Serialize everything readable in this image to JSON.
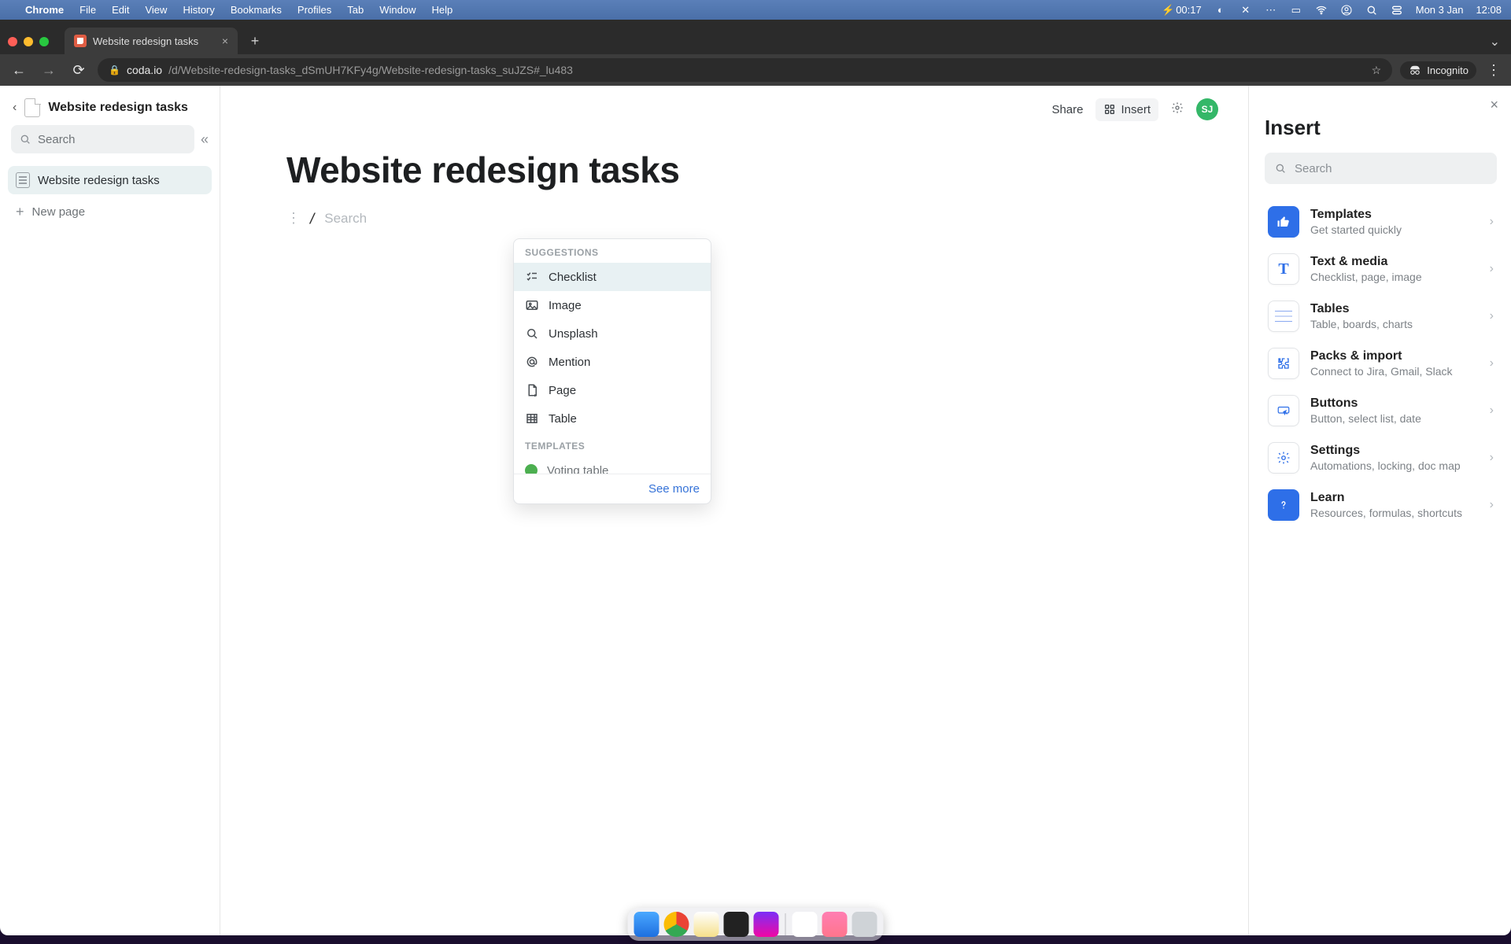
{
  "mac_menu": {
    "app": "Chrome",
    "items": [
      "File",
      "Edit",
      "View",
      "History",
      "Bookmarks",
      "Profiles",
      "Tab",
      "Window",
      "Help"
    ],
    "battery_time": "00:17",
    "date": "Mon 3 Jan",
    "clock": "12:08"
  },
  "browser": {
    "tab_title": "Website redesign tasks",
    "url_host": "coda.io",
    "url_path": "/d/Website-redesign-tasks_dSmUH7KFy4g/Website-redesign-tasks_suJZS#_lu483",
    "incognito_label": "Incognito"
  },
  "sidebar": {
    "doc_title": "Website redesign tasks",
    "search_placeholder": "Search",
    "active_page": "Website redesign tasks",
    "new_page_label": "New page"
  },
  "doc": {
    "title": "Website redesign tasks",
    "slash_placeholder": "Search"
  },
  "popover": {
    "suggestions_label": "SUGGESTIONS",
    "templates_label": "TEMPLATES",
    "items": [
      {
        "label": "Checklist",
        "icon": "checklist"
      },
      {
        "label": "Image",
        "icon": "image"
      },
      {
        "label": "Unsplash",
        "icon": "search"
      },
      {
        "label": "Mention",
        "icon": "at"
      },
      {
        "label": "Page",
        "icon": "page"
      },
      {
        "label": "Table",
        "icon": "table"
      }
    ],
    "template_item": "Voting table",
    "see_more": "See more"
  },
  "header": {
    "share": "Share",
    "insert": "Insert",
    "avatar_initials": "SJ"
  },
  "insert_panel": {
    "title": "Insert",
    "search_placeholder": "Search",
    "categories": [
      {
        "title": "Templates",
        "subtitle": "Get started quickly",
        "icon": "thumbs-up"
      },
      {
        "title": "Text & media",
        "subtitle": "Checklist, page, image",
        "icon": "text"
      },
      {
        "title": "Tables",
        "subtitle": "Table, boards, charts",
        "icon": "tables"
      },
      {
        "title": "Packs & import",
        "subtitle": "Connect to Jira, Gmail, Slack",
        "icon": "puzzle"
      },
      {
        "title": "Buttons",
        "subtitle": "Button, select list, date",
        "icon": "button"
      },
      {
        "title": "Settings",
        "subtitle": "Automations, locking, doc map",
        "icon": "gear"
      },
      {
        "title": "Learn",
        "subtitle": "Resources, formulas, shortcuts",
        "icon": "help"
      }
    ]
  }
}
